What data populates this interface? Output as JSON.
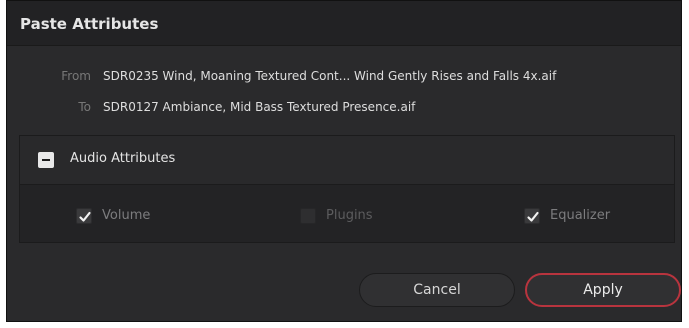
{
  "dialog": {
    "title": "Paste Attributes"
  },
  "paths": {
    "from_label": "From",
    "from_value": "SDR0235 Wind, Moaning Textured Cont... Wind Gently Rises and Falls 4x.aif",
    "to_label": "To",
    "to_value": "SDR0127 Ambiance, Mid Bass Textured Presence.aif"
  },
  "audio_attributes": {
    "title": "Audio Attributes",
    "items": [
      {
        "label": "Volume",
        "checked": true,
        "enabled": true
      },
      {
        "label": "Plugins",
        "checked": false,
        "enabled": false
      },
      {
        "label": "Equalizer",
        "checked": true,
        "enabled": true
      }
    ]
  },
  "buttons": {
    "cancel_label": "Cancel",
    "apply_label": "Apply"
  },
  "colors": {
    "accent": "#b8343e",
    "dialog_background": "#2a2a2c"
  }
}
